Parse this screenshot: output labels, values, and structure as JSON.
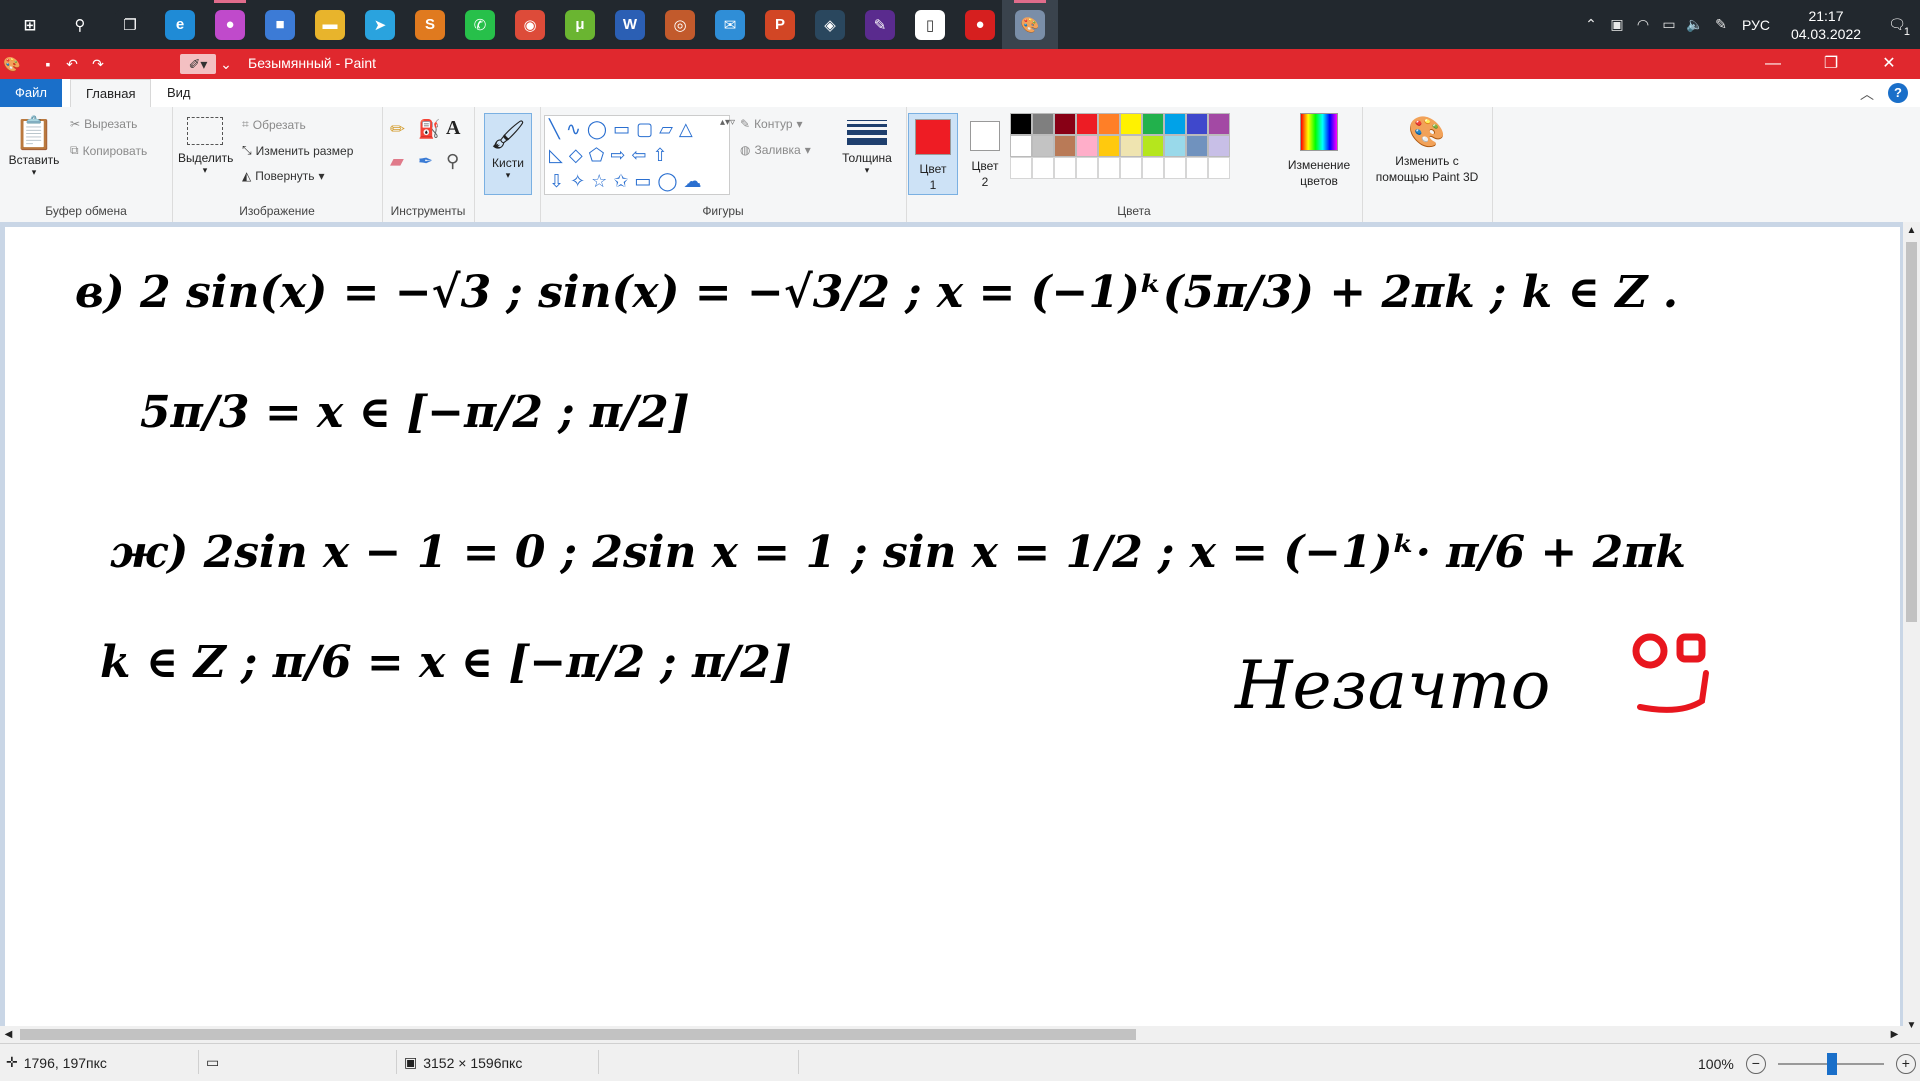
{
  "taskbar": {
    "apps": [
      {
        "name": "start",
        "glyph": "⊞",
        "color": "#22282e"
      },
      {
        "name": "search",
        "glyph": "⚲",
        "color": "#22282e"
      },
      {
        "name": "task-view",
        "glyph": "❐",
        "color": "#22282e"
      },
      {
        "name": "edge",
        "glyph": "e",
        "color": "#1f8bd6"
      },
      {
        "name": "paint-drop",
        "glyph": "●",
        "color": "#c04acb"
      },
      {
        "name": "store",
        "glyph": "■",
        "color": "#3c7bd6"
      },
      {
        "name": "explorer",
        "glyph": "▬",
        "color": "#e8b42c"
      },
      {
        "name": "telegram",
        "glyph": "➤",
        "color": "#2aa3de"
      },
      {
        "name": "sublime",
        "glyph": "S",
        "color": "#e07a1f"
      },
      {
        "name": "whatsapp",
        "glyph": "✆",
        "color": "#27c04a"
      },
      {
        "name": "chrome",
        "glyph": "◉",
        "color": "#dd4b39"
      },
      {
        "name": "utorrent",
        "glyph": "μ",
        "color": "#6ab531"
      },
      {
        "name": "word",
        "glyph": "W",
        "color": "#2b5fb4"
      },
      {
        "name": "media",
        "glyph": "◎",
        "color": "#c25a2c"
      },
      {
        "name": "mail",
        "glyph": "✉",
        "color": "#2f8ed7"
      },
      {
        "name": "powerpoint",
        "glyph": "P",
        "color": "#d24625"
      },
      {
        "name": "steam",
        "glyph": "◈",
        "color": "#2a475e"
      },
      {
        "name": "app-purple",
        "glyph": "✎",
        "color": "#5a2b8e"
      },
      {
        "name": "document",
        "glyph": "▯",
        "color": "#ffffff"
      },
      {
        "name": "recorder",
        "glyph": "●",
        "color": "#d61f1f"
      },
      {
        "name": "paint",
        "glyph": "🎨",
        "color": "#7a8ea8"
      }
    ],
    "lang": "РУС",
    "time": "21:17",
    "date": "04.03.2022",
    "notifications": "1"
  },
  "window": {
    "title": "Безымянный - Paint"
  },
  "tabs": {
    "file": "Файл",
    "home": "Главная",
    "view": "Вид"
  },
  "ribbon": {
    "clipboard": {
      "label": "Буфер обмена",
      "paste": "Вставить",
      "cut": "Вырезать",
      "copy": "Копировать"
    },
    "image": {
      "label": "Изображение",
      "select": "Выделить",
      "crop": "Обрезать",
      "resize": "Изменить размер",
      "rotate": "Повернуть"
    },
    "tools": {
      "label": "Инструменты"
    },
    "brushes": {
      "label": "Кисти"
    },
    "shapes": {
      "label": "Фигуры",
      "outline": "Контур",
      "fill": "Заливка"
    },
    "size": {
      "label": "Толщина"
    },
    "colors": {
      "label": "Цвета",
      "color1": "Цвет 1",
      "color2": "Цвет 2",
      "color1_value": "#ee1c24",
      "color2_value": "#ffffff",
      "edit": "Изменение цветов",
      "palette_row1": [
        "#000000",
        "#7f7f7f",
        "#880015",
        "#ed1c24",
        "#ff7f27",
        "#fff200",
        "#22b14c",
        "#00a2e8",
        "#3f48cc",
        "#a349a4"
      ],
      "palette_row2": [
        "#ffffff",
        "#c3c3c3",
        "#b97a57",
        "#ffaec9",
        "#ffc90e",
        "#efe4b0",
        "#b5e61d",
        "#99d9ea",
        "#7092be",
        "#c8bfe7"
      ],
      "palette_row3": [
        "#ffffff",
        "#ffffff",
        "#ffffff",
        "#ffffff",
        "#ffffff",
        "#ffffff",
        "#ffffff",
        "#ffffff",
        "#ffffff",
        "#ffffff"
      ]
    },
    "paint3d": "Изменить с помощью Paint 3D"
  },
  "canvas": {
    "lines": [
      "в) 2 sin(x) = −√3 ;  sin(x) = −√3/2 ;  x = (−1)ᵏ(5π/3) + 2πk ; k ∈ Z .",
      "5π/3 = x ∈ [−π/2 ; π/2]",
      "ж) 2sin x − 1 = 0 ; 2sin x = 1 ; sin x = 1/2 ; x = (−1)ᵏ· π/6 + 2πk",
      "k ∈ Z ;   π/6 = x ∈ [−π/2 ; π/2]",
      "Незачто"
    ],
    "smiley": "◡̈"
  },
  "status": {
    "cursor": "1796, 197пкс",
    "selection": "",
    "size": "3152 × 1596пкс",
    "zoom": "100%"
  }
}
